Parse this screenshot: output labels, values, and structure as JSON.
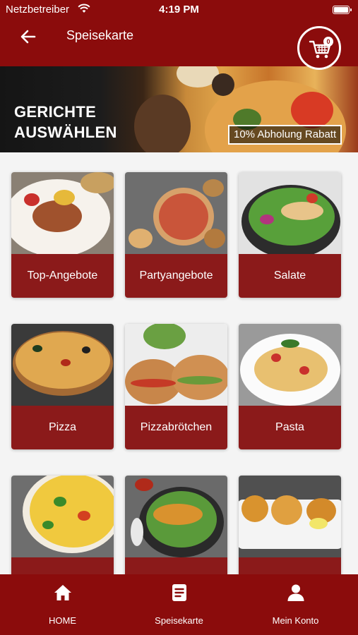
{
  "status": {
    "carrier": "Netzbetreiber",
    "time": "4:19 PM"
  },
  "header": {
    "title": "Speisekarte",
    "cart_count": "0"
  },
  "banner": {
    "headline_line1": "GERICHTE",
    "headline_line2": "AUSWÄHLEN",
    "promo": "10% Abholung Rabatt"
  },
  "categories": [
    {
      "label": "Top-Angebote"
    },
    {
      "label": "Partyangebote"
    },
    {
      "label": "Salate"
    },
    {
      "label": "Pizza"
    },
    {
      "label": "Pizzabrötchen"
    },
    {
      "label": "Pasta"
    },
    {
      "label": ""
    },
    {
      "label": ""
    },
    {
      "label": ""
    }
  ],
  "nav": {
    "home": "HOME",
    "menu": "Speisekarte",
    "account": "Mein Konto"
  },
  "colors": {
    "brand": "#8b0c0c",
    "card_label": "#8b1a1a"
  },
  "icons": [
    "wifi-icon",
    "back-arrow-icon",
    "cart-icon",
    "home-icon",
    "menu-icon",
    "user-icon"
  ]
}
